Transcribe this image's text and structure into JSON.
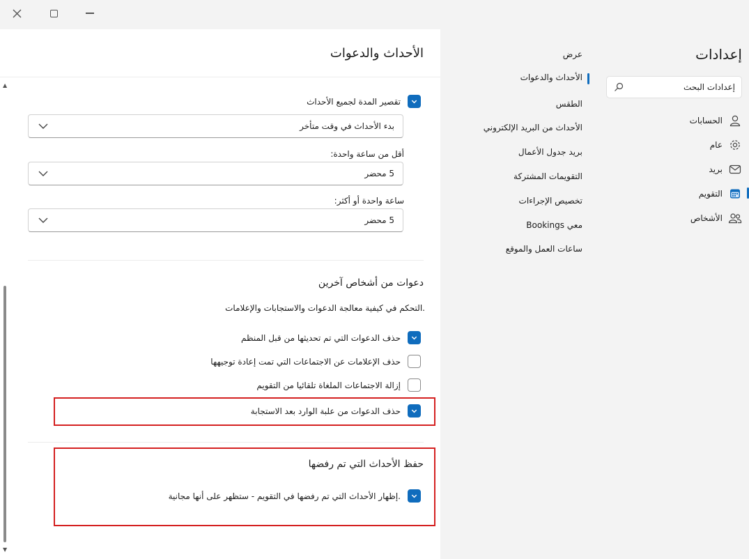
{
  "window": {
    "close_icon": "close-icon",
    "maximize_icon": "maximize-icon",
    "minimize_icon": "minimize-icon"
  },
  "app": {
    "title": "إعدادات",
    "search_placeholder": "إعدادات البحث"
  },
  "nav_main": [
    {
      "label": "الحسابات",
      "icon": "person-icon"
    },
    {
      "label": "عام",
      "icon": "gear-icon"
    },
    {
      "label": "بريد",
      "icon": "mail-icon"
    },
    {
      "label": "التقويم",
      "icon": "calendar-icon",
      "selected": true
    },
    {
      "label": "الأشخاص",
      "icon": "people-icon"
    }
  ],
  "nav_calendar": [
    {
      "label": "عرض"
    },
    {
      "label": "الأحداث والدعوات",
      "selected": true
    },
    {
      "label": "الطقس"
    },
    {
      "label": "الأحداث من البريد الإلكتروني"
    },
    {
      "label": "بريد جدول الأعمال"
    },
    {
      "label": "التقويمات المشتركة"
    },
    {
      "label": "تخصيص الإجراءات"
    },
    {
      "label": "Bookings معي"
    },
    {
      "label": "ساعات العمل والموقع"
    }
  ],
  "content": {
    "title": "الأحداث والدعوات",
    "shorten": {
      "label": "تقصير المدة لجميع الأحداث",
      "checked": true,
      "dropdown_value": "بدء الأحداث في وقت متأخر"
    },
    "less_than_hour": {
      "label": "أقل من ساعة واحدة:",
      "value": "5 محضر"
    },
    "hour_or_more": {
      "label": "ساعة واحدة أو أكثر:",
      "value": "5 محضر"
    },
    "invitations": {
      "title": "دعوات من أشخاص آخرين",
      "description": "التحكم في كيفية معالجة الدعوات والاستجابات والإعلامات.",
      "options": [
        {
          "label": "حذف الدعوات التي تم تحديثها من قبل المنظم",
          "checked": true
        },
        {
          "label": "حذف الإعلامات عن الاجتماعات التي تمت إعادة توجيهها",
          "checked": false
        },
        {
          "label": "إزالة الاجتماعات الملغاة تلقائيا من التقويم",
          "checked": false
        },
        {
          "label": "حذف الدعوات من علبة الوارد بعد الاستجابة",
          "checked": true
        }
      ]
    },
    "declined": {
      "title": "حفظ الأحداث التي تم رفضها",
      "option": {
        "label": "إظهار الأحداث التي تم رفضها في التقويم - ستظهر على أنها مجانية.",
        "checked": true
      }
    }
  },
  "colors": {
    "accent": "#0f6cbd",
    "highlight": "#d42020"
  }
}
